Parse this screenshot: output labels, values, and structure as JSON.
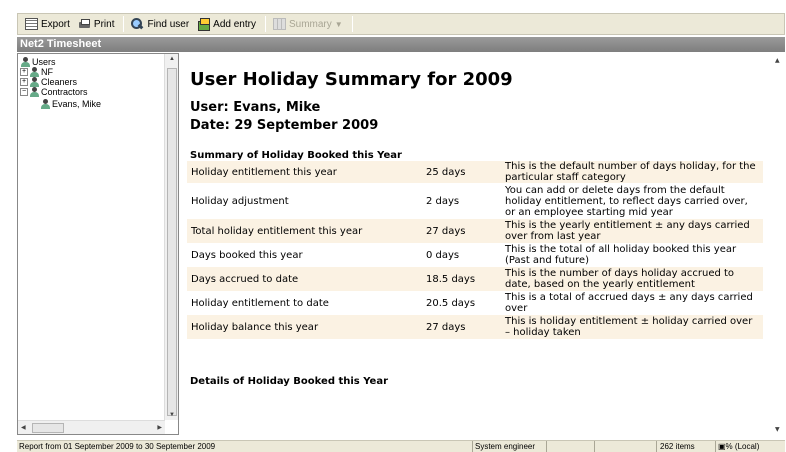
{
  "toolbar": {
    "export_label": "Export",
    "print_label": "Print",
    "find_user_label": "Find user",
    "add_entry_label": "Add entry",
    "summary_label": "Summary"
  },
  "title_bar": "Net2 Timesheet",
  "tree": {
    "items": [
      {
        "label": "Users"
      },
      {
        "label": "NF"
      },
      {
        "label": "Cleaners"
      },
      {
        "label": "Contractors"
      },
      {
        "label": "Evans, Mike"
      }
    ]
  },
  "report": {
    "title": "User Holiday Summary for 2009",
    "user": "User: Evans, Mike",
    "date": "Date: 29 September 2009",
    "summary_heading": "Summary of Holiday Booked this Year",
    "rows": [
      {
        "label": "Holiday entitlement this year",
        "value": "25 days",
        "note": "This is the default number of days holiday, for the particular staff category"
      },
      {
        "label": "Holiday adjustment",
        "value": "2 days",
        "note": "You can add or delete days from the default holiday entitlement, to reflect days carried over, or an employee starting mid year"
      },
      {
        "label": "Total holiday entitlement this year",
        "value": "27 days",
        "note": "This is the yearly entitlement ± any days carried over from last year"
      },
      {
        "label": "Days booked this year",
        "value": "0 days",
        "note": "This is the total of all holiday booked this year (Past and future)"
      },
      {
        "label": "Days accrued to date",
        "value": "18.5 days",
        "note": "This is the number of days holiday accrued to date, based on the yearly entitlement"
      },
      {
        "label": "Holiday entitlement to date",
        "value": "20.5 days",
        "note": "This is a total of accrued days ± any days carried over"
      },
      {
        "label": "Holiday balance this year",
        "value": "27 days",
        "note": "This is holiday entitlement ± holiday carried over – holiday taken"
      }
    ],
    "details_heading": "Details of Holiday Booked this Year"
  },
  "statusbar": {
    "report_range": "Report from 01 September 2009 to 30 September 2009",
    "role": "System engineer",
    "items": "262 items",
    "location": "(Local)"
  }
}
